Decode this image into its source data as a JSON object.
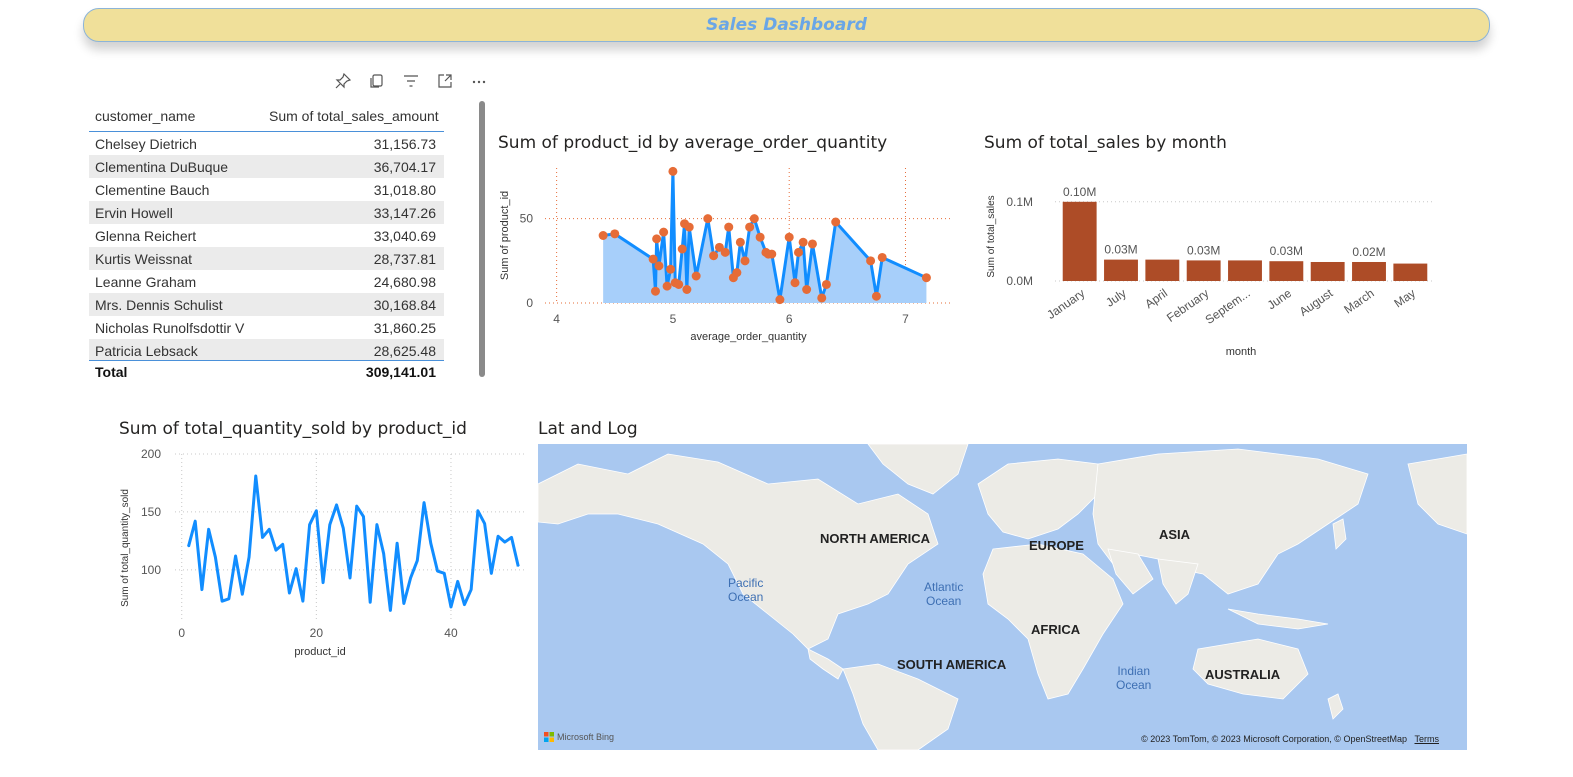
{
  "dashboard": {
    "title": "Sales Dashboard"
  },
  "toolbar": {
    "icons": [
      "pin-icon",
      "copy-icon",
      "filter-icon",
      "focus-mode-icon",
      "more-options-icon"
    ]
  },
  "table": {
    "headers": [
      "customer_name",
      "Sum of total_sales_amount"
    ],
    "rows": [
      [
        "Chelsey Dietrich",
        "31,156.73"
      ],
      [
        "Clementina DuBuque",
        "36,704.17"
      ],
      [
        "Clementine Bauch",
        "31,018.80"
      ],
      [
        "Ervin Howell",
        "33,147.26"
      ],
      [
        "Glenna Reichert",
        "33,040.69"
      ],
      [
        "Kurtis Weissnat",
        "28,737.81"
      ],
      [
        "Leanne Graham",
        "24,680.98"
      ],
      [
        "Mrs. Dennis Schulist",
        "30,168.84"
      ],
      [
        "Nicholas Runolfsdottir V",
        "31,860.25"
      ],
      [
        "Patricia Lebsack",
        "28,625.48"
      ]
    ],
    "total_label": "Total",
    "total_value": "309,141.01"
  },
  "chart1": {
    "title": "Sum of product_id by average_order_quantity"
  },
  "chart2": {
    "title": "Sum of total_sales by month"
  },
  "chart3": {
    "title": "Sum of total_quantity_sold by product_id"
  },
  "map": {
    "title": "Lat and Log",
    "continents": [
      "NORTH AMERICA",
      "EUROPE",
      "ASIA",
      "AFRICA",
      "SOUTH AMERICA",
      "AUSTRALIA"
    ],
    "oceans": [
      [
        "Pacific",
        "Ocean"
      ],
      [
        "Atlantic",
        "Ocean"
      ],
      [
        "Indian",
        "Ocean"
      ]
    ],
    "bing": "Microsoft Bing",
    "attribution": "© 2023 TomTom, © 2023 Microsoft Corporation, © OpenStreetMap",
    "terms": "Terms",
    "colors": {
      "water": "#a9c8f0",
      "land": "#ecebe6"
    }
  },
  "chart_data": [
    {
      "type": "area",
      "title": "Sum of product_id by average_order_quantity",
      "xlabel": "average_order_quantity",
      "ylabel": "Sum of product_id",
      "xlim": [
        3.9,
        7.4
      ],
      "ylim": [
        0,
        80
      ],
      "x_ticks": [
        4,
        5,
        6,
        7
      ],
      "y_ticks": [
        0,
        50
      ],
      "line_color": "#118dff",
      "fill_color": "#a7cffa",
      "marker_color": "#e66c37",
      "points": [
        [
          4.4,
          40
        ],
        [
          4.5,
          41
        ],
        [
          4.83,
          26
        ],
        [
          4.85,
          7
        ],
        [
          4.86,
          38
        ],
        [
          4.88,
          22
        ],
        [
          4.92,
          42
        ],
        [
          4.95,
          10
        ],
        [
          4.98,
          20
        ],
        [
          5.0,
          78
        ],
        [
          5.02,
          12
        ],
        [
          5.05,
          11
        ],
        [
          5.08,
          32
        ],
        [
          5.1,
          47
        ],
        [
          5.12,
          8
        ],
        [
          5.14,
          45
        ],
        [
          5.2,
          16
        ],
        [
          5.3,
          50
        ],
        [
          5.35,
          28
        ],
        [
          5.4,
          33
        ],
        [
          5.45,
          30
        ],
        [
          5.48,
          45
        ],
        [
          5.52,
          15
        ],
        [
          5.55,
          18
        ],
        [
          5.58,
          36
        ],
        [
          5.62,
          25
        ],
        [
          5.66,
          45
        ],
        [
          5.7,
          50
        ],
        [
          5.75,
          39
        ],
        [
          5.8,
          30
        ],
        [
          5.82,
          29
        ],
        [
          5.85,
          29
        ],
        [
          5.92,
          2
        ],
        [
          6.0,
          39
        ],
        [
          6.05,
          12
        ],
        [
          6.08,
          30
        ],
        [
          6.12,
          36
        ],
        [
          6.15,
          8
        ],
        [
          6.2,
          35
        ],
        [
          6.28,
          3
        ],
        [
          6.32,
          11
        ],
        [
          6.4,
          48
        ],
        [
          6.7,
          25
        ],
        [
          6.75,
          4
        ],
        [
          6.8,
          27
        ],
        [
          7.18,
          15
        ]
      ]
    },
    {
      "type": "bar",
      "title": "Sum of total_sales by month",
      "xlabel": "month",
      "ylabel": "Sum of total_sales",
      "categories": [
        "January",
        "July",
        "April",
        "February",
        "Septem...",
        "June",
        "August",
        "March",
        "May"
      ],
      "values": [
        0.1,
        0.027,
        0.027,
        0.026,
        0.026,
        0.025,
        0.024,
        0.024,
        0.022
      ],
      "data_labels": [
        "0.10M",
        "0.03M",
        "",
        "0.03M",
        "",
        "0.03M",
        "",
        "0.02M",
        ""
      ],
      "ylim": [
        0,
        0.125
      ],
      "y_ticks": [
        0,
        0.1
      ],
      "y_tick_labels": [
        "0.0M",
        "0.1M"
      ],
      "bar_color": "#ad4c27"
    },
    {
      "type": "line",
      "title": "Sum of total_quantity_sold by product_id",
      "xlabel": "product_id",
      "ylabel": "Sum of total_quantity_sold",
      "xlim": [
        -1,
        51
      ],
      "ylim": [
        55,
        200
      ],
      "x_ticks": [
        0,
        20,
        40
      ],
      "y_ticks": [
        100,
        150,
        200
      ],
      "line_color": "#118dff",
      "x": [
        1,
        2,
        3,
        4,
        5,
        6,
        7,
        8,
        9,
        10,
        11,
        12,
        13,
        14,
        15,
        16,
        17,
        18,
        19,
        20,
        21,
        22,
        23,
        24,
        25,
        26,
        27,
        28,
        29,
        30,
        31,
        32,
        33,
        34,
        35,
        36,
        37,
        38,
        39,
        40,
        41,
        42,
        43,
        44,
        45,
        46,
        47,
        48,
        49,
        50
      ],
      "values": [
        120,
        142,
        83,
        135,
        111,
        73,
        75,
        112,
        79,
        111,
        181,
        128,
        135,
        117,
        122,
        80,
        101,
        73,
        139,
        151,
        89,
        139,
        156,
        136,
        93,
        155,
        146,
        72,
        139,
        114,
        65,
        123,
        71,
        93,
        108,
        158,
        123,
        99,
        97,
        68,
        90,
        70,
        83,
        151,
        140,
        97,
        129,
        124,
        128,
        103
      ]
    }
  ]
}
